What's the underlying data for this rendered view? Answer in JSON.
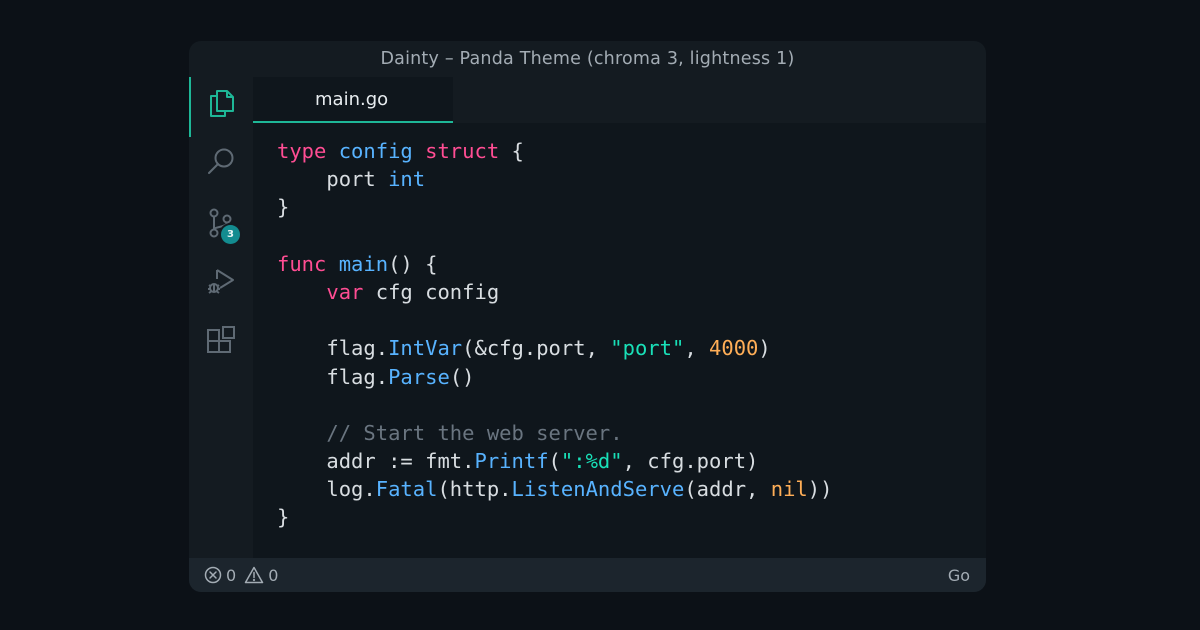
{
  "window": {
    "title": "Dainty – Panda Theme (chroma 3, lightness 1)"
  },
  "activity_bar": {
    "items": [
      {
        "icon": "files-icon",
        "active": true
      },
      {
        "icon": "search-icon",
        "active": false
      },
      {
        "icon": "source-control-icon",
        "active": false,
        "badge": "3"
      },
      {
        "icon": "run-debug-icon",
        "active": false
      },
      {
        "icon": "extensions-icon",
        "active": false
      }
    ]
  },
  "tabs": [
    {
      "label": "main.go",
      "active": true
    }
  ],
  "editor": {
    "lines": [
      [
        {
          "t": "type",
          "c": "kw"
        },
        {
          "t": " ",
          "c": "pl"
        },
        {
          "t": "config",
          "c": "ty"
        },
        {
          "t": " ",
          "c": "pl"
        },
        {
          "t": "struct",
          "c": "kw"
        },
        {
          "t": " {",
          "c": "pl"
        }
      ],
      [
        {
          "t": "    port ",
          "c": "pl"
        },
        {
          "t": "int",
          "c": "ty"
        }
      ],
      [
        {
          "t": "}",
          "c": "pl"
        }
      ],
      [],
      [
        {
          "t": "func",
          "c": "kw"
        },
        {
          "t": " ",
          "c": "pl"
        },
        {
          "t": "main",
          "c": "fn"
        },
        {
          "t": "() {",
          "c": "pl"
        }
      ],
      [
        {
          "t": "    ",
          "c": "pl"
        },
        {
          "t": "var",
          "c": "kw"
        },
        {
          "t": " cfg config",
          "c": "pl"
        }
      ],
      [],
      [
        {
          "t": "    flag.",
          "c": "pl"
        },
        {
          "t": "IntVar",
          "c": "fn"
        },
        {
          "t": "(&cfg.port, ",
          "c": "pl"
        },
        {
          "t": "\"port\"",
          "c": "str"
        },
        {
          "t": ", ",
          "c": "pl"
        },
        {
          "t": "4000",
          "c": "num"
        },
        {
          "t": ")",
          "c": "pl"
        }
      ],
      [
        {
          "t": "    flag.",
          "c": "pl"
        },
        {
          "t": "Parse",
          "c": "fn"
        },
        {
          "t": "()",
          "c": "pl"
        }
      ],
      [],
      [
        {
          "t": "    // Start the web server.",
          "c": "cm"
        }
      ],
      [
        {
          "t": "    addr := fmt.",
          "c": "pl"
        },
        {
          "t": "Printf",
          "c": "fn"
        },
        {
          "t": "(",
          "c": "pl"
        },
        {
          "t": "\":%d\"",
          "c": "str"
        },
        {
          "t": ", cfg.port)",
          "c": "pl"
        }
      ],
      [
        {
          "t": "    log.",
          "c": "pl"
        },
        {
          "t": "Fatal",
          "c": "fn"
        },
        {
          "t": "(http.",
          "c": "pl"
        },
        {
          "t": "ListenAndServe",
          "c": "fn"
        },
        {
          "t": "(addr, ",
          "c": "pl"
        },
        {
          "t": "nil",
          "c": "num"
        },
        {
          "t": "))",
          "c": "pl"
        }
      ],
      [
        {
          "t": "}",
          "c": "pl"
        }
      ]
    ]
  },
  "statusbar": {
    "errors": "0",
    "warnings": "0",
    "language": "Go"
  },
  "colors": {
    "accent": "#1eb797",
    "badge": "#138c90",
    "keyword": "#ff4d93",
    "function": "#58b3ff",
    "string": "#19e0b8",
    "number": "#ffae57",
    "comment": "#6a7580"
  }
}
